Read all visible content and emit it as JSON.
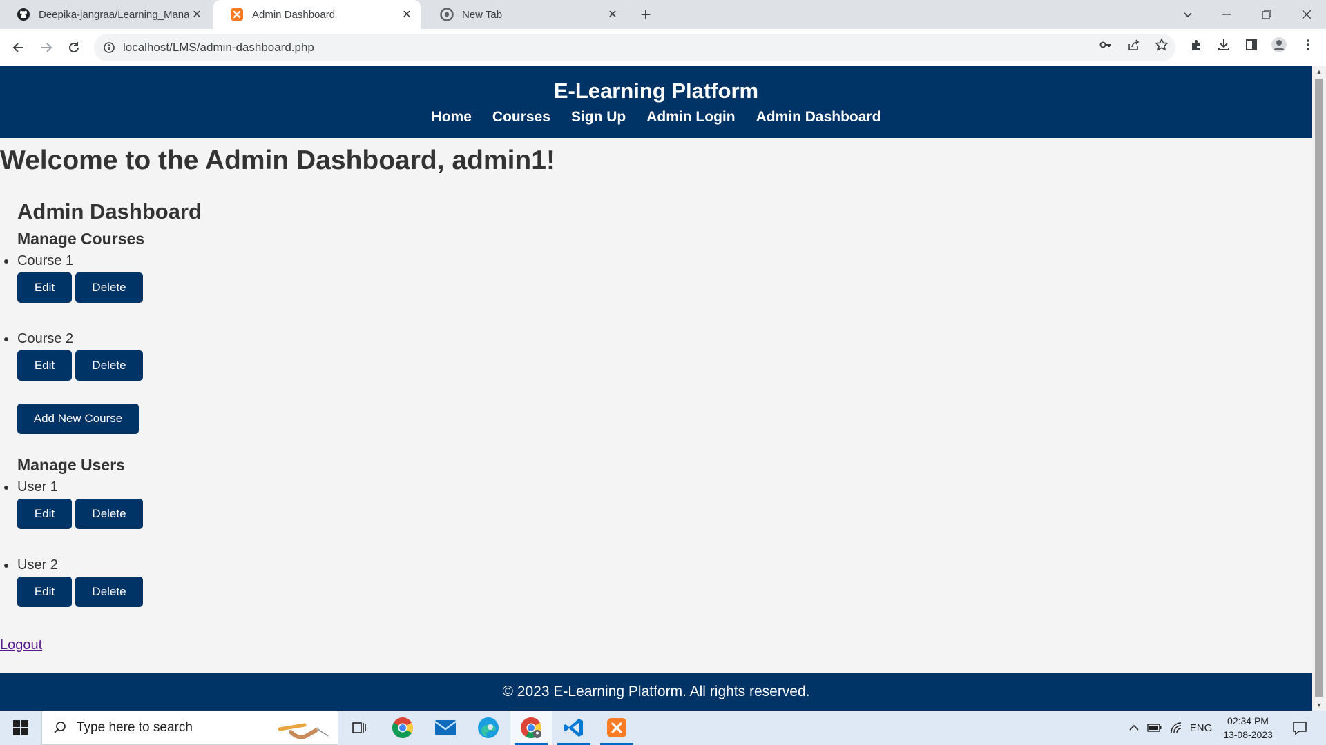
{
  "browser": {
    "tabs": [
      {
        "title": "Deepika-jangraa/Learning_Mana",
        "icon": "github-icon"
      },
      {
        "title": "Admin Dashboard",
        "icon": "xampp-icon",
        "active": true
      },
      {
        "title": "New Tab",
        "icon": "chrome-icon"
      }
    ],
    "url": "localhost/LMS/admin-dashboard.php"
  },
  "site": {
    "title": "E-Learning Platform",
    "nav": [
      "Home",
      "Courses",
      "Sign Up",
      "Admin Login",
      "Admin Dashboard"
    ],
    "footer": "© 2023 E-Learning Platform. All rights reserved."
  },
  "page": {
    "welcome": "Welcome to the Admin Dashboard, admin1!",
    "heading": "Admin Dashboard",
    "courses_heading": "Manage Courses",
    "courses": [
      "Course 1",
      "Course 2"
    ],
    "users_heading": "Manage Users",
    "users": [
      "User 1",
      "User 2"
    ],
    "edit_label": "Edit",
    "delete_label": "Delete",
    "add_course_label": "Add New Course",
    "logout_label": "Logout"
  },
  "taskbar": {
    "search_placeholder": "Type here to search",
    "language": "ENG",
    "time": "02:34 PM",
    "date": "13-08-2023"
  },
  "colors": {
    "brand": "#003366",
    "background": "#f4f4f4",
    "text": "#333333",
    "link_visited": "#551a8b"
  }
}
